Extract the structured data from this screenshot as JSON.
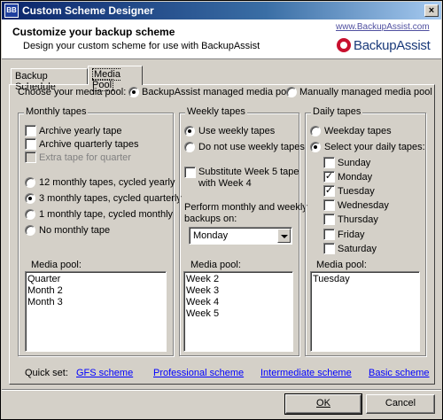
{
  "window": {
    "title": "Custom Scheme Designer",
    "app_icon_text": "BB"
  },
  "header": {
    "title": "Customize your backup scheme",
    "subtitle": "Design your custom scheme for use with BackupAssist",
    "url": "www.BackupAssist.com",
    "logo_text": "BackupAssist"
  },
  "tabs": [
    {
      "label": "Backup Schedule",
      "selected": false
    },
    {
      "label": "Media Pool",
      "selected": true
    }
  ],
  "pool_choice": {
    "prompt": "Choose your media pool:",
    "options": [
      {
        "label": "BackupAssist managed media pool",
        "selected": true
      },
      {
        "label": "Manually managed media pool",
        "selected": false
      }
    ]
  },
  "monthly": {
    "title": "Monthly tapes",
    "checks": [
      {
        "label": "Archive yearly tape",
        "checked": false,
        "enabled": true
      },
      {
        "label": "Archive quarterly tapes",
        "checked": false,
        "enabled": true
      },
      {
        "label": "Extra tape for quarter",
        "checked": false,
        "enabled": false
      }
    ],
    "radios": [
      {
        "label": "12 monthly tapes, cycled yearly",
        "selected": false
      },
      {
        "label": "3 monthly tapes, cycled quarterly",
        "selected": true
      },
      {
        "label": "1 monthly tape, cycled monthly",
        "selected": false
      },
      {
        "label": "No monthly tape",
        "selected": false
      }
    ],
    "pool_label": "Media pool:",
    "pool_items": [
      "Quarter",
      "Month 2",
      "Month 3"
    ]
  },
  "weekly": {
    "title": "Weekly tapes",
    "radios": [
      {
        "label": "Use weekly tapes",
        "selected": true
      },
      {
        "label": "Do not use weekly tapes",
        "selected": false
      }
    ],
    "substitute": {
      "label_line1": "Substitute Week 5 tape",
      "label_line2": "with Week 4",
      "checked": false
    },
    "perform_label_line1": "Perform monthly and weekly",
    "perform_label_line2": "backups on:",
    "day_select": "Monday",
    "pool_label": "Media pool:",
    "pool_items": [
      "Week 2",
      "Week 3",
      "Week 4",
      "Week 5"
    ]
  },
  "daily": {
    "title": "Daily tapes",
    "radios": [
      {
        "label": "Weekday tapes",
        "selected": false
      },
      {
        "label": "Select your daily tapes:",
        "selected": true
      }
    ],
    "days": [
      {
        "label": "Sunday",
        "checked": false
      },
      {
        "label": "Monday",
        "checked": true
      },
      {
        "label": "Tuesday",
        "checked": true
      },
      {
        "label": "Wednesday",
        "checked": false
      },
      {
        "label": "Thursday",
        "checked": false
      },
      {
        "label": "Friday",
        "checked": false
      },
      {
        "label": "Saturday",
        "checked": false
      }
    ],
    "pool_label": "Media pool:",
    "pool_items": [
      "Tuesday"
    ]
  },
  "quick_set": {
    "label": "Quick set:",
    "links": [
      "GFS scheme",
      "Professional scheme",
      "Intermediate scheme",
      "Basic scheme"
    ]
  },
  "buttons": {
    "ok": "OK",
    "cancel": "Cancel"
  },
  "check_mark": "✓",
  "close_glyph": "×"
}
